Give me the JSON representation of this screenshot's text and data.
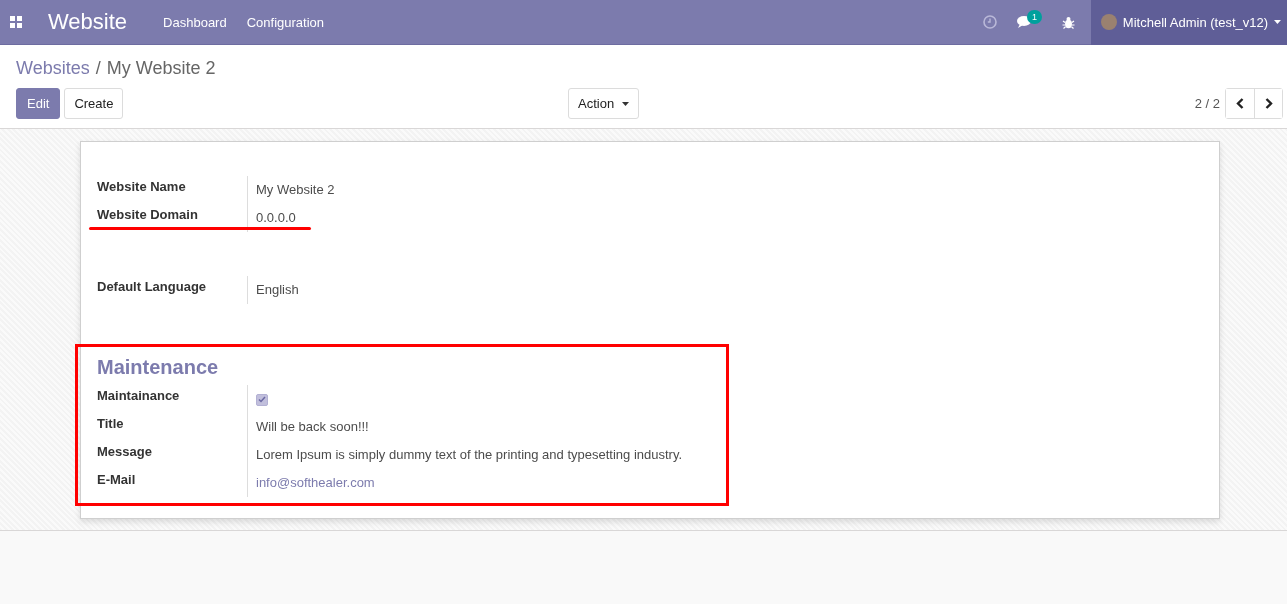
{
  "navbar": {
    "app_name": "Website",
    "menu": [
      "Dashboard",
      "Configuration"
    ],
    "chat_count": "1",
    "user": "Mitchell Admin (test_v12)"
  },
  "breadcrumb": {
    "parent": "Websites",
    "separator": "/",
    "current": "My Website 2"
  },
  "buttons": {
    "edit": "Edit",
    "create": "Create",
    "action": "Action"
  },
  "pager": "2 / 2",
  "groups": [
    {
      "underlined": true,
      "highlighted": false,
      "fields": [
        {
          "label": "Website Name",
          "kind": "text",
          "value": "My Website 2"
        },
        {
          "label": "Website Domain",
          "kind": "text",
          "value": "0.0.0.0"
        }
      ]
    },
    {
      "underlined": false,
      "highlighted": false,
      "fields": [
        {
          "label": "Default Language",
          "kind": "text",
          "value": "English"
        }
      ]
    },
    {
      "title": "Maintenance",
      "underlined": false,
      "highlighted": true,
      "fields": [
        {
          "label": "Maintainance",
          "kind": "checkbox",
          "checked": true
        },
        {
          "label": "Title",
          "kind": "text",
          "value": "Will be back soon!!!"
        },
        {
          "label": "Message",
          "kind": "text",
          "value": "Lorem Ipsum is simply dummy text of the printing and typesetting industry."
        },
        {
          "label": "E-Mail",
          "kind": "link",
          "value": "info@softhealer.com"
        }
      ]
    }
  ]
}
